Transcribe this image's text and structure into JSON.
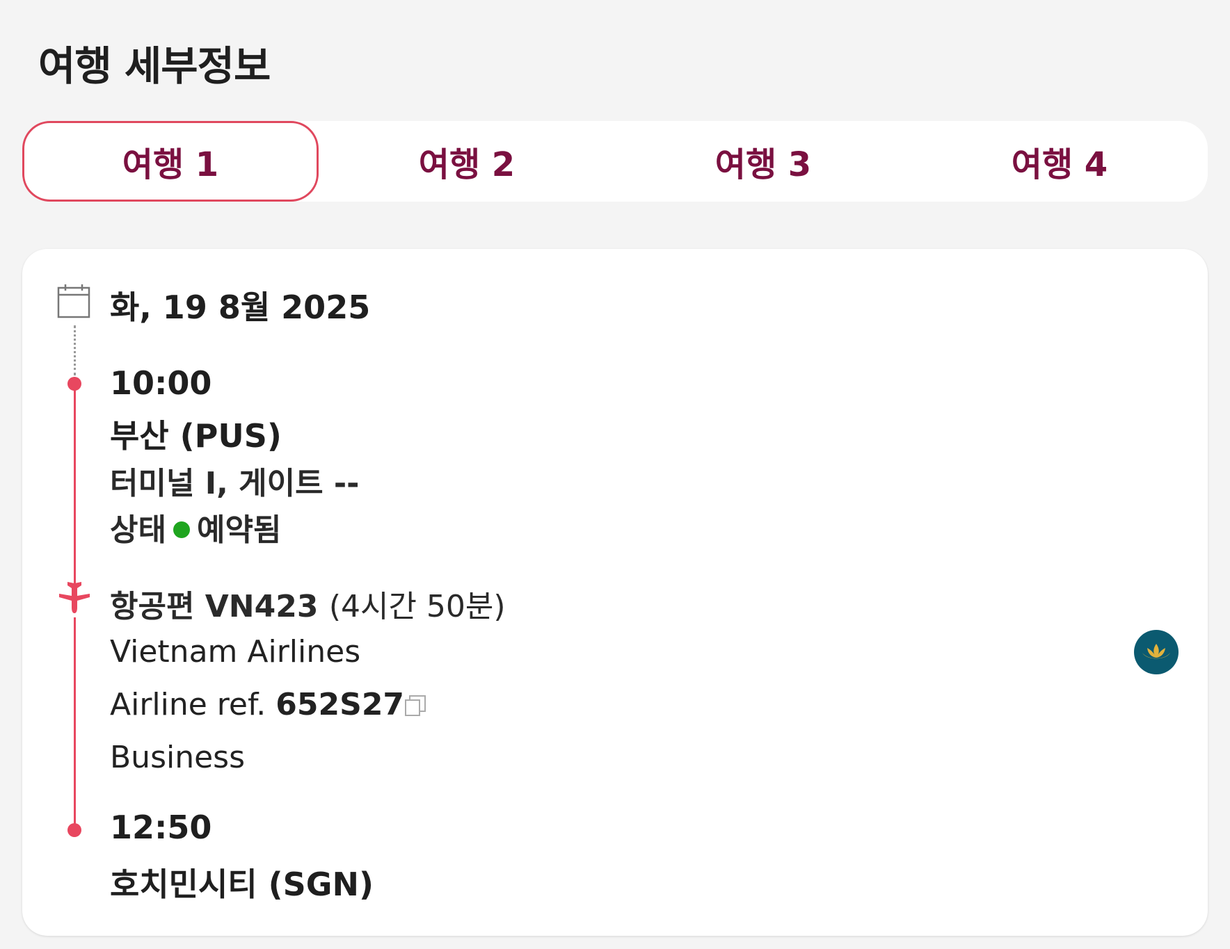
{
  "header": {
    "title": "여행 세부정보"
  },
  "tabs": [
    {
      "label": "여행 1",
      "active": true
    },
    {
      "label": "여행 2",
      "active": false
    },
    {
      "label": "여행 3",
      "active": false
    },
    {
      "label": "여행 4",
      "active": false
    }
  ],
  "trip": {
    "date": "화, 19 8월 2025",
    "departure": {
      "time": "10:00",
      "airport": "부산 (PUS)",
      "terminal_gate": "터미널 I, 게이트 --",
      "status_label": "상태",
      "status_value": "예약됨"
    },
    "flight": {
      "number_label": "항공편 VN423",
      "duration": "(4시간 50분)",
      "airline": "Vietnam Airlines",
      "ref_label": "Airline ref.",
      "ref_value": "652S27",
      "cabin": "Business"
    },
    "arrival": {
      "time": "12:50",
      "airport": "호치민시티 (SGN)"
    }
  },
  "colors": {
    "accent": "#e8475f",
    "tab_text": "#7a1040",
    "status_ok": "#1fa51f",
    "airline_logo_bg": "#0b5a70"
  },
  "icons": [
    "calendar-icon",
    "plane-icon",
    "copy-icon",
    "airline-logo"
  ]
}
